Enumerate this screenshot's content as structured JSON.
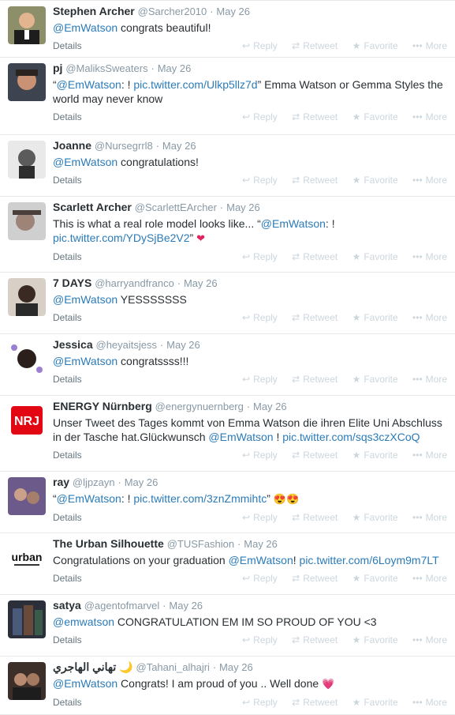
{
  "actions": {
    "reply": "Reply",
    "retweet": "Retweet",
    "favorite": "Favorite",
    "more": "More",
    "details": "Details"
  },
  "tweets": [
    {
      "name": "Stephen Archer",
      "handle": "@Sarcher2010",
      "dot": "·",
      "time": "May 26",
      "parts": [
        {
          "t": "@EmWatson",
          "link": true
        },
        {
          "t": " congrats beautiful!"
        }
      ]
    },
    {
      "name": "pj",
      "handle": "@MaliksSweaters",
      "dot": "·",
      "time": "May 26",
      "parts": [
        {
          "t": "“"
        },
        {
          "t": "@EmWatson",
          "link": true
        },
        {
          "t": ": ! "
        },
        {
          "t": "pic.twitter.com/Ulkp5llz7d",
          "link": true
        },
        {
          "t": "” Emma Watson or Gemma Styles the world may never know"
        }
      ]
    },
    {
      "name": "Joanne",
      "handle": "@Nursegrrl8",
      "dot": "·",
      "time": "May 26",
      "parts": [
        {
          "t": "@EmWatson",
          "link": true
        },
        {
          "t": " congratulations!"
        }
      ]
    },
    {
      "name": "Scarlett Archer",
      "handle": "@ScarlettEArcher",
      "dot": "·",
      "time": "May 26",
      "parts": [
        {
          "t": "This is what a real role model looks like... “"
        },
        {
          "t": "@EmWatson",
          "link": true
        },
        {
          "t": ": ! "
        },
        {
          "t": "pic.twitter.com/YDySjBe2V2",
          "link": true
        },
        {
          "t": "” "
        },
        {
          "t": "❤",
          "emoji": true,
          "heart": true
        }
      ]
    },
    {
      "name": "7 DAYS",
      "handle": "@harryandfranco",
      "dot": "·",
      "time": "May 26",
      "parts": [
        {
          "t": "@EmWatson",
          "link": true
        },
        {
          "t": " YESSSSSSS"
        }
      ]
    },
    {
      "name": "Jessica",
      "handle": "@heyaitsjess",
      "dot": "·",
      "time": "May 26",
      "parts": [
        {
          "t": "@EmWatson",
          "link": true
        },
        {
          "t": " congratssss!!!"
        }
      ]
    },
    {
      "name": "ENERGY Nürnberg",
      "handle": "@energynuernberg",
      "dot": "·",
      "time": "May 26",
      "parts": [
        {
          "t": "Unser Tweet des Tages kommt von Emma Watson die ihren Elite Uni Abschluss in der Tasche hat.Glückwunsch "
        },
        {
          "t": "@EmWatson",
          "link": true
        },
        {
          "t": " ! "
        },
        {
          "t": "pic.twitter.com/sqs3czXCoQ",
          "link": true
        }
      ]
    },
    {
      "name": "ray",
      "handle": "@ljpzayn",
      "dot": "·",
      "time": "May 26",
      "parts": [
        {
          "t": "“"
        },
        {
          "t": "@EmWatson",
          "link": true
        },
        {
          "t": ": ! "
        },
        {
          "t": "pic.twitter.com/3znZmmihtc",
          "link": true
        },
        {
          "t": "” "
        },
        {
          "t": "😍😍",
          "emoji": true
        }
      ]
    },
    {
      "name": "The Urban Silhouette",
      "handle": "@TUSFashion",
      "dot": "·",
      "time": "May 26",
      "parts": [
        {
          "t": "Congratulations on your graduation "
        },
        {
          "t": "@EmWatson",
          "link": true
        },
        {
          "t": "! "
        },
        {
          "t": "pic.twitter.com/6Loym9m7LT",
          "link": true
        }
      ]
    },
    {
      "name": "satya",
      "handle": "@agentofmarvel",
      "dot": "·",
      "time": "May 26",
      "parts": [
        {
          "t": "@emwatson",
          "link": true
        },
        {
          "t": " CONGRATULATION EM IM SO PROUD OF YOU <3"
        }
      ]
    },
    {
      "name": "تهاني الهاجري 🌙",
      "handle": "@Tahani_alhajri",
      "dot": "·",
      "time": "May 26",
      "parts": [
        {
          "t": "@EmWatson",
          "link": true
        },
        {
          "t": " Congrats! I am proud of you .. Well done "
        },
        {
          "t": "💗",
          "emoji": true
        }
      ]
    }
  ]
}
